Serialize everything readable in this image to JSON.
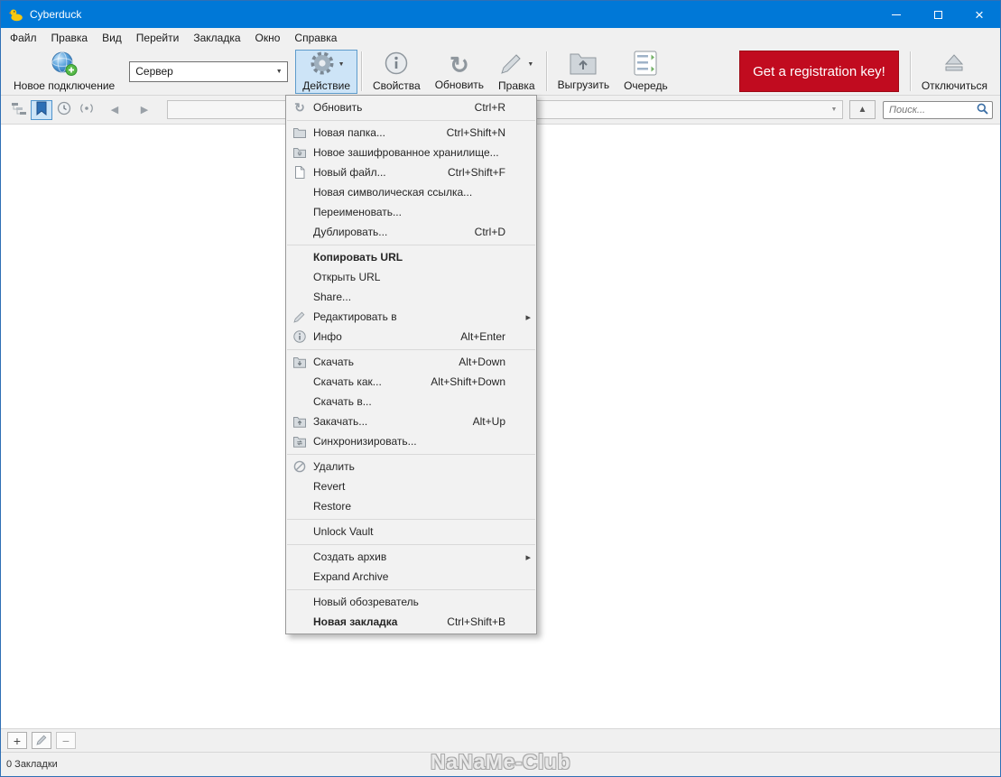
{
  "titlebar": {
    "title": "Cyberduck"
  },
  "menubar": {
    "items": [
      "Файл",
      "Правка",
      "Вид",
      "Перейти",
      "Закладка",
      "Окно",
      "Справка"
    ]
  },
  "toolbar": {
    "new_connection_label": "Новое подключение",
    "server_value": "Сервер",
    "action_label": "Действие",
    "properties_label": "Свойства",
    "refresh_label": "Обновить",
    "edit_label": "Правка",
    "upload_label": "Выгрузить",
    "queue_label": "Очередь",
    "registration_label": "Get a registration key!",
    "disconnect_label": "Отключиться"
  },
  "navbar": {
    "search_placeholder": "Поиск..."
  },
  "action_menu": {
    "items": [
      {
        "label": "Обновить",
        "shortcut": "Ctrl+R"
      },
      {
        "label": "Новая папка...",
        "shortcut": "Ctrl+Shift+N"
      },
      {
        "label": "Новое зашифрованное хранилище..."
      },
      {
        "label": "Новый файл...",
        "shortcut": "Ctrl+Shift+F"
      },
      {
        "label": "Новая символическая ссылка..."
      },
      {
        "label": "Переименовать..."
      },
      {
        "label": "Дублировать...",
        "shortcut": "Ctrl+D"
      },
      {
        "label": "Копировать URL"
      },
      {
        "label": "Открыть URL"
      },
      {
        "label": "Share..."
      },
      {
        "label": "Редактировать в"
      },
      {
        "label": "Инфо",
        "shortcut": "Alt+Enter"
      },
      {
        "label": "Скачать",
        "shortcut": "Alt+Down"
      },
      {
        "label": "Скачать как...",
        "shortcut": "Alt+Shift+Down"
      },
      {
        "label": "Скачать в..."
      },
      {
        "label": "Закачать...",
        "shortcut": "Alt+Up"
      },
      {
        "label": "Синхронизировать..."
      },
      {
        "label": "Удалить"
      },
      {
        "label": "Revert"
      },
      {
        "label": "Restore"
      },
      {
        "label": "Unlock Vault"
      },
      {
        "label": "Создать архив"
      },
      {
        "label": "Expand Archive"
      },
      {
        "label": "Новый обозреватель"
      },
      {
        "label": "Новая закладка",
        "shortcut": "Ctrl+Shift+B"
      }
    ]
  },
  "bottom_toolbar": {
    "add": "+",
    "remove": "−"
  },
  "statusbar": {
    "text": "0 Закладки"
  },
  "watermark": "NaNaMe-Club",
  "icons": {
    "dropdown_arrow": "▼",
    "back_arrow": "◀",
    "forward_arrow": "▶",
    "up_arrow": "▲",
    "submenu_arrow": "▸",
    "refresh_glyph": "↻",
    "close_glyph": "×"
  },
  "colors": {
    "titlebar_blue": "#0078d7",
    "registration_red": "#c10b1f",
    "pressed_blue": "#cde4f7"
  }
}
